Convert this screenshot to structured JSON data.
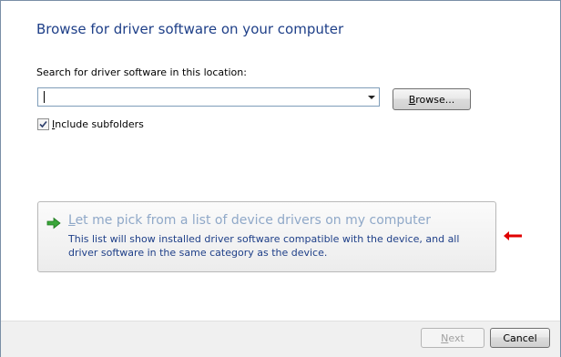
{
  "dialog": {
    "title": "Browse for driver software on your computer",
    "search_label": "Search for driver software in this location:",
    "search_value": "",
    "browse_button": "Browse...",
    "include_subfolders": {
      "label": "Include subfolders",
      "checked": true
    },
    "pick_option": {
      "title_underlined": "L",
      "title_rest": "et me pick from a list of device drivers on my computer",
      "description": "This list will show installed driver software compatible with the device, and all driver software in the same category as the device."
    },
    "next_button": "Next",
    "cancel_button": "Cancel"
  },
  "colors": {
    "title": "#1e3f88",
    "pick_title": "#8fa8c8",
    "pick_description": "#1e3f88",
    "pointer_arrow": "#e00000"
  }
}
